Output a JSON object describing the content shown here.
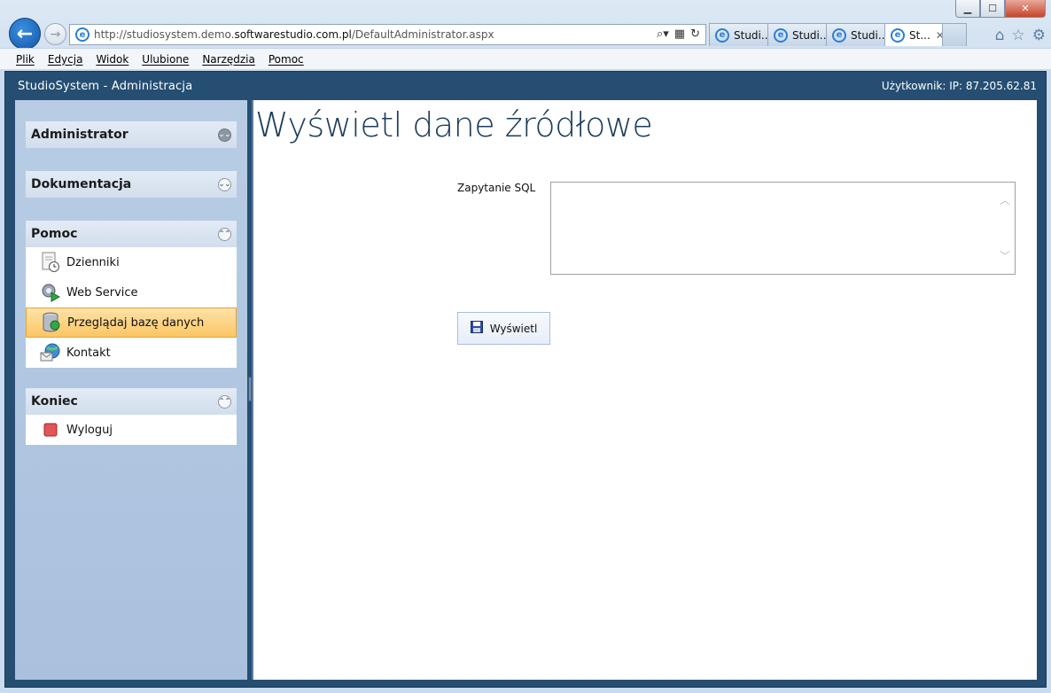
{
  "browser": {
    "window_controls": {
      "minimize": "▁",
      "maximize": "☐",
      "close": "✕"
    },
    "url": {
      "prefix": "http://studiosystem.demo.",
      "domain": "softwarestudio.com.pl",
      "path": "/DefaultAdministrator.aspx"
    },
    "tabs": [
      {
        "label": "Studi..."
      },
      {
        "label": "Studi..."
      },
      {
        "label": "Studi..."
      },
      {
        "label": "St..."
      }
    ],
    "menu": [
      "Plik",
      "Edycja",
      "Widok",
      "Ulubione",
      "Narzędzia",
      "Pomoc"
    ]
  },
  "app": {
    "title": "StudioSystem - Administracja",
    "user_info": "Użytkownik: IP: 87.205.62.81"
  },
  "sidebar": {
    "sections": [
      {
        "label": "Administrator",
        "state": "collapsed"
      },
      {
        "label": "Dokumentacja",
        "state": "collapsed"
      },
      {
        "label": "Pomoc",
        "state": "expanded",
        "items": [
          {
            "label": "Dzienniki",
            "icon": "log-document-icon"
          },
          {
            "label": "Web Service",
            "icon": "gear-play-icon"
          },
          {
            "label": "Przeglądaj bazę danych",
            "icon": "database-icon",
            "selected": true
          },
          {
            "label": "Kontakt",
            "icon": "globe-mail-icon"
          }
        ]
      },
      {
        "label": "Koniec",
        "state": "expanded",
        "items": [
          {
            "label": "Wyloguj",
            "icon": "stop-icon"
          }
        ]
      }
    ]
  },
  "main": {
    "title": "Wyświetl dane źródłowe",
    "sql_label": "Zapytanie SQL",
    "sql_value": "",
    "show_button": "Wyświetl"
  },
  "colors": {
    "header_bg": "#254e72",
    "sidebar_bg": "#b8cde4",
    "selected_item": "#fbc664",
    "title_color": "#1d3c5a"
  }
}
